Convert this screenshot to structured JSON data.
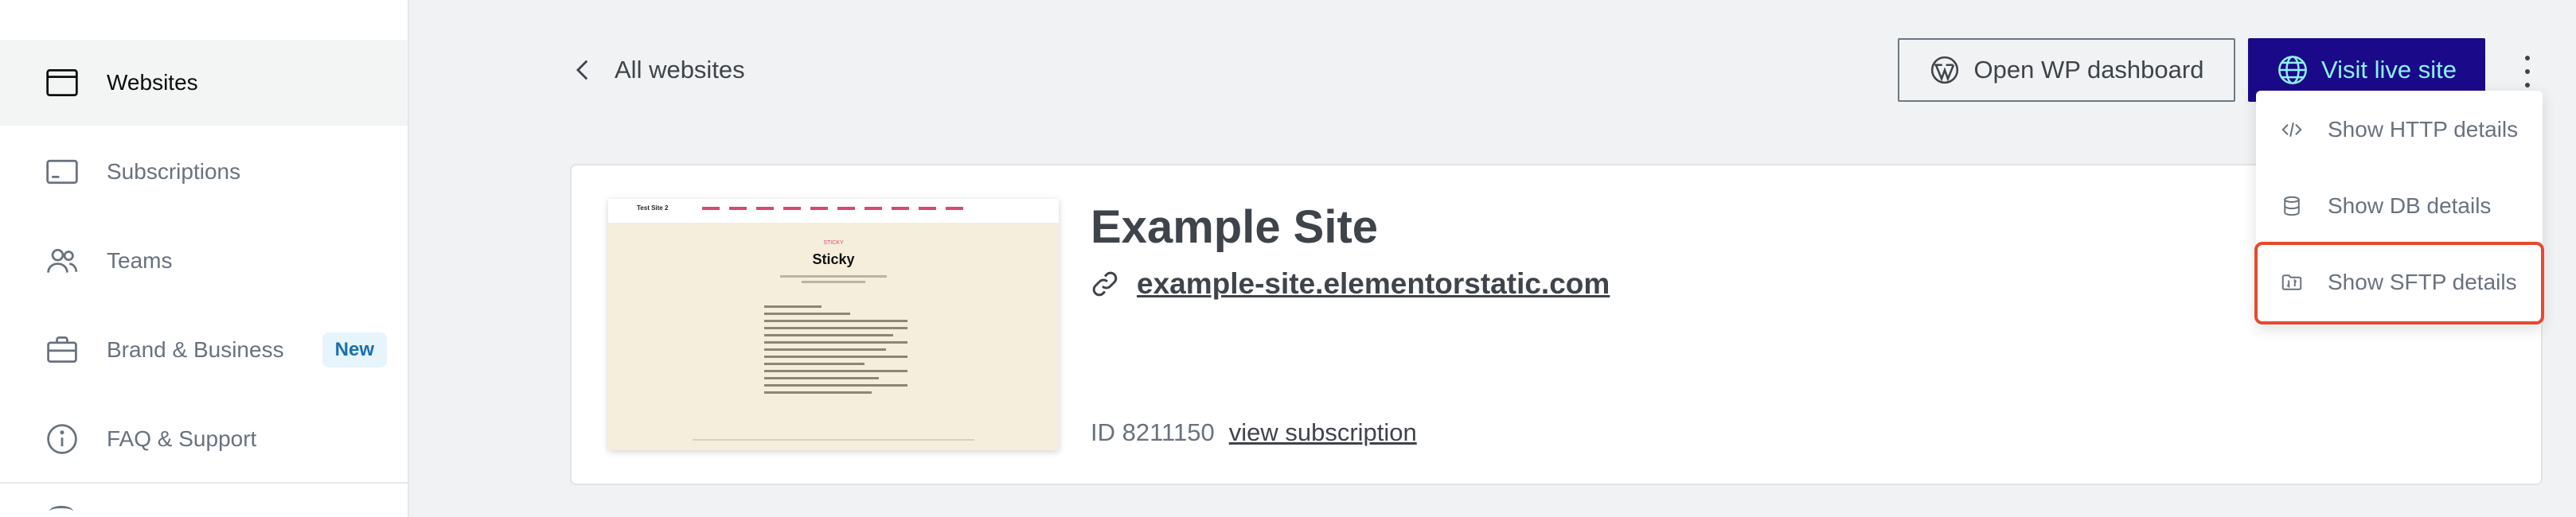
{
  "sidebar": {
    "items": [
      {
        "label": "Websites",
        "icon": "browser-window-icon"
      },
      {
        "label": "Subscriptions",
        "icon": "credit-card-icon"
      },
      {
        "label": "Teams",
        "icon": "users-icon"
      },
      {
        "label": "Brand & Business",
        "icon": "briefcase-icon",
        "badge": "New"
      },
      {
        "label": "FAQ & Support",
        "icon": "info-circle-icon"
      }
    ]
  },
  "header": {
    "back_label": "All websites",
    "open_wp_label": "Open WP dashboard",
    "visit_label": "Visit live site"
  },
  "site": {
    "name": "Example Site",
    "url": "example-site.elementorstatic.com",
    "id_label": "ID 8211150",
    "subscription_link": "view subscription",
    "thumbnail": {
      "logo": "Test Site 2",
      "kicker": "STICKY",
      "title": "Sticky"
    }
  },
  "menu": {
    "items": [
      {
        "label": "Show HTTP details",
        "icon": "code-icon"
      },
      {
        "label": "Show DB details",
        "icon": "database-icon"
      },
      {
        "label": "Show SFTP details",
        "icon": "sftp-folder-icon"
      }
    ]
  },
  "colors": {
    "primary_button_bg": "#1a0a8a",
    "primary_button_text": "#8ef0f0",
    "highlight": "#e8492e",
    "badge_bg": "#e6f4fb",
    "badge_text": "#1a6fb0"
  }
}
